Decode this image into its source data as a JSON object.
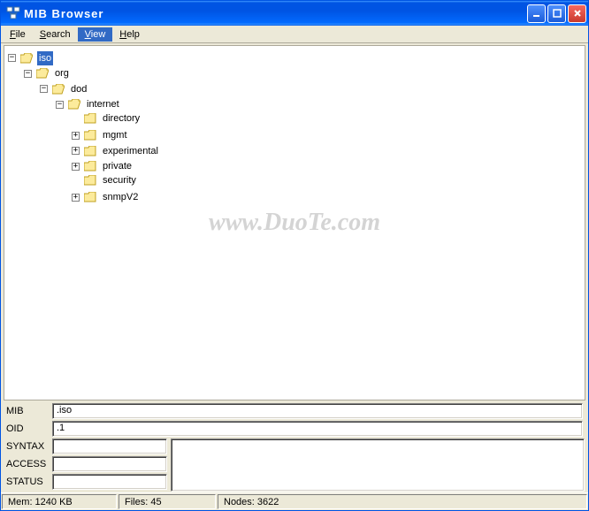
{
  "title": "MIB Browser",
  "menu": {
    "file": "File",
    "search": "Search",
    "view": "View",
    "help": "Help"
  },
  "tree": {
    "root": {
      "label": "iso",
      "selected": true,
      "expanded": true
    },
    "org": {
      "label": "org",
      "expanded": true
    },
    "dod": {
      "label": "dod",
      "expanded": true
    },
    "internet": {
      "label": "internet",
      "expanded": true
    },
    "children": {
      "directory": {
        "label": "directory",
        "expandable": false
      },
      "mgmt": {
        "label": "mgmt",
        "expandable": true
      },
      "experimental": {
        "label": "experimental",
        "expandable": true
      },
      "private": {
        "label": "private",
        "expandable": true
      },
      "security": {
        "label": "security",
        "expandable": false
      },
      "snmpV2": {
        "label": "snmpV2",
        "expandable": true
      }
    }
  },
  "fields": {
    "mib_label": "MIB",
    "mib_value": ".iso",
    "oid_label": "OID",
    "oid_value": ".1",
    "syntax_label": "SYNTAX",
    "syntax_value": "",
    "access_label": "ACCESS",
    "access_value": "",
    "status_label": "STATUS",
    "status_value": "",
    "description_value": ""
  },
  "statusbar": {
    "mem": "Mem: 1240 KB",
    "files": "Files: 45",
    "nodes": "Nodes: 3622"
  },
  "watermark": "www.DuoTe.com"
}
